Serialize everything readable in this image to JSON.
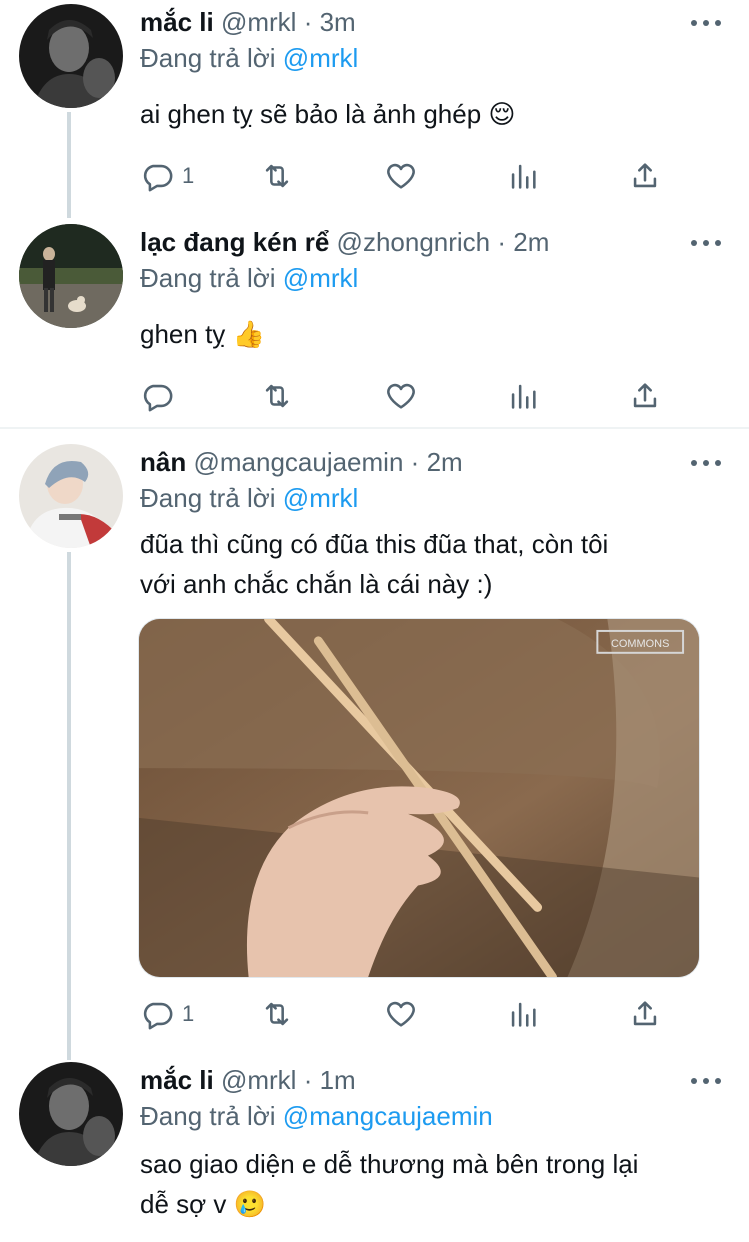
{
  "colors": {
    "link": "#1d9bf0",
    "secondary": "#536471",
    "text": "#0f1419",
    "thread_line": "#cfd9de"
  },
  "tweets": [
    {
      "name": "mắc li",
      "handle": "@mrkl",
      "dot": "·",
      "time": "3m",
      "replying_prefix": "Đang trả lời",
      "replying_to": "@mrkl",
      "text": "ai ghen tỵ sẽ bảo là ảnh ghép 😌",
      "reply_count": "1",
      "avatar_icon": "avatar-mrkl"
    },
    {
      "name": "lạc đang kén rể",
      "handle": "@zhongnrich",
      "dot": "·",
      "time": "2m",
      "replying_prefix": "Đang trả lời",
      "replying_to": "@mrkl",
      "text": "ghen tỵ 👍",
      "reply_count": "",
      "avatar_icon": "avatar-zhongnrich"
    },
    {
      "name": "nân",
      "handle": "@mangcaujaemin",
      "dot": "·",
      "time": "2m",
      "replying_prefix": "Đang trả lời",
      "replying_to": "@mrkl",
      "text_line1": "đũa thì cũng có đũa this đũa that, còn tôi",
      "text_line2": "với anh chắc chắn là cái này :)",
      "media_watermark": "COMMONS",
      "reply_count": "1",
      "avatar_icon": "avatar-mangcaujaemin"
    },
    {
      "name": "mắc li",
      "handle": "@mrkl",
      "dot": "·",
      "time": "1m",
      "replying_prefix": "Đang trả lời",
      "replying_to": "@mangcaujaemin",
      "text_line1": "sao giao diện e dễ thương mà bên trong lại",
      "text_line2": "dễ sợ v 🥲",
      "avatar_icon": "avatar-mrkl"
    }
  ],
  "action_icons": [
    "reply-icon",
    "retweet-icon",
    "like-icon",
    "analytics-icon",
    "share-icon"
  ]
}
